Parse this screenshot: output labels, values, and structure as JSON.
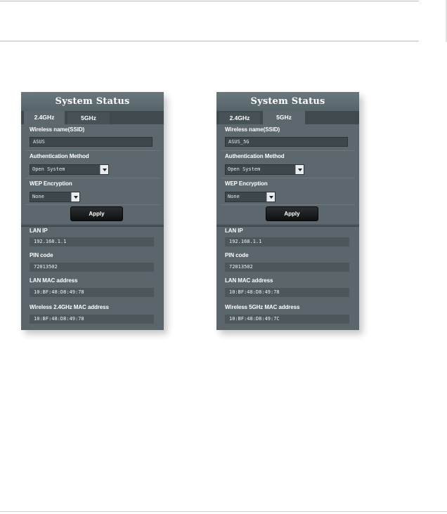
{
  "panels": [
    {
      "title": "System Status",
      "tabs": [
        {
          "label": "2.4GHz",
          "active": true
        },
        {
          "label": "5GHz",
          "active": false
        }
      ],
      "ssid_label": "Wireless name(SSID)",
      "ssid_value": "ASUS",
      "auth_label": "Authentication Method",
      "auth_value": "Open System",
      "wep_label": "WEP Encryption",
      "wep_value": "None",
      "apply_label": "Apply",
      "lan_ip_label": "LAN IP",
      "lan_ip_value": "192.168.1.1",
      "pin_label": "PIN code",
      "pin_value": "72013502",
      "lan_mac_label": "LAN MAC address",
      "lan_mac_value": "10:BF:48:D8:49:78",
      "wireless_mac_label": "Wireless 2.4GHz MAC address",
      "wireless_mac_value": "10:BF:48:D8:49:78"
    },
    {
      "title": "System Status",
      "tabs": [
        {
          "label": "2.4GHz",
          "active": false
        },
        {
          "label": "5GHz",
          "active": true
        }
      ],
      "ssid_label": "Wireless name(SSID)",
      "ssid_value": "ASUS_5G",
      "auth_label": "Authentication Method",
      "auth_value": "Open System",
      "wep_label": "WEP Encryption",
      "wep_value": "None",
      "apply_label": "Apply",
      "lan_ip_label": "LAN IP",
      "lan_ip_value": "192.168.1.1",
      "pin_label": "PIN code",
      "pin_value": "72013502",
      "lan_mac_label": "LAN MAC address",
      "lan_mac_value": "10:BF:48:D8:49:78",
      "wireless_mac_label": "Wireless 5GHz MAC address",
      "wireless_mac_value": "10:BF:48:D8:49:7C"
    }
  ],
  "icons": {
    "dropdown": "chevron-down-icon"
  },
  "colors": {
    "panel_bg": "#4e5a60",
    "field_bg": "#3e474c",
    "button_bg": "#111314"
  }
}
